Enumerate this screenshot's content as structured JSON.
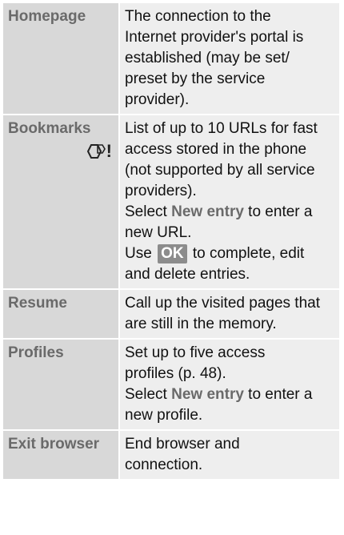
{
  "rows": [
    {
      "term": "Homepage",
      "lines": [
        "The connection to the",
        "Internet provider's portal is",
        "established (may be set/",
        "preset by the service",
        "provider)."
      ]
    },
    {
      "term": "Bookmarks",
      "icon_text": "!",
      "lines": [
        "List of up to 10 URLs for fast",
        "access stored in the phone",
        "(not supported by all service",
        "providers)."
      ],
      "select_prefix": "Select ",
      "select_kw": "New entry",
      "select_suffix": " to enter a",
      "select_line2": "new URL.",
      "use_prefix": "Use ",
      "ok_label": "OK",
      "use_suffix": " to complete, edit",
      "use_line2": "and delete entries."
    },
    {
      "term": "Resume",
      "lines": [
        "Call up the visited pages that",
        "are still in the memory."
      ]
    },
    {
      "term": "Profiles",
      "lines": [
        "Set up to five access",
        "profiles (p. 48)."
      ],
      "select_prefix": "Select ",
      "select_kw": "New entry",
      "select_suffix": " to enter a",
      "select_line2": "new profile."
    },
    {
      "term": "Exit browser",
      "lines": [
        "End browser and",
        "connection."
      ]
    }
  ]
}
